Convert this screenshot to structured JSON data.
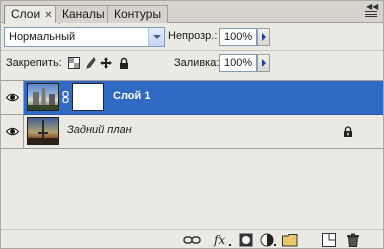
{
  "tabs": [
    {
      "label": "Слои",
      "active": true,
      "closable": true
    },
    {
      "label": "Каналы",
      "active": false
    },
    {
      "label": "Контуры",
      "active": false
    }
  ],
  "blend_mode": {
    "value": "Нормальный"
  },
  "opacity": {
    "label": "Непрозр.:",
    "value": "100%"
  },
  "lock": {
    "label": "Закрепить:",
    "icons": [
      "lock-transparent-icon",
      "lock-pixels-brush-icon",
      "lock-position-move-icon",
      "lock-all-icon"
    ]
  },
  "fill": {
    "label": "Заливка:",
    "value": "100%"
  },
  "layers": [
    {
      "name": "Слой 1",
      "selected": true,
      "visible": true,
      "has_mask": true
    },
    {
      "name": "Задний план",
      "selected": false,
      "visible": true,
      "locked": true
    }
  ],
  "toolbar_icons": [
    "link-layers-icon",
    "fx-icon",
    "add-mask-icon",
    "adjustment-layer-icon",
    "new-group-icon",
    "new-layer-icon",
    "delete-trash-icon"
  ],
  "colors": {
    "selection": "#316ac5",
    "panel_bg": "#ebe9e4"
  }
}
